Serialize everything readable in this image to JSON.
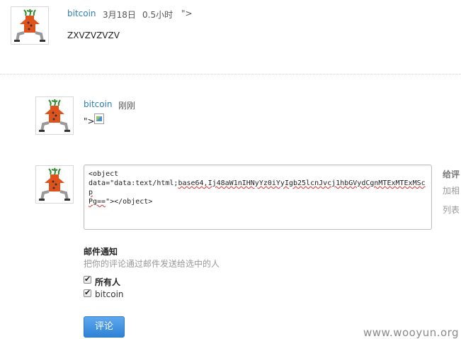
{
  "comment1": {
    "author": "bitcoin",
    "date": "3月18日",
    "duration": "0.5小时",
    "tail": "\">",
    "body": "ZXVZVZVZV"
  },
  "comment2": {
    "author": "bitcoin",
    "time": "刚刚",
    "body_prefix": "\">"
  },
  "composer": {
    "textarea_prefix": "<object\ndata=\"data:text/html;",
    "textarea_misspelled": "base64,Ij48aW1nIHNyYz0iYyIgb25lcnJvcj1hbGVydCgnMTExMTExMScp\nPg==",
    "textarea_suffix": "\"></object>",
    "side_tips": [
      "给评",
      "加相",
      "列表"
    ]
  },
  "notify": {
    "title": "邮件通知",
    "description": "把你的评论通过邮件发送给选中的人",
    "options": [
      {
        "label": "所有人",
        "checked": true
      },
      {
        "label": "bitcoin",
        "checked": true
      }
    ]
  },
  "submit_label": "评论",
  "watermark": "www.wooyun.org",
  "colors": {
    "link": "#2a7fb5",
    "button": "#3a8fe0"
  }
}
